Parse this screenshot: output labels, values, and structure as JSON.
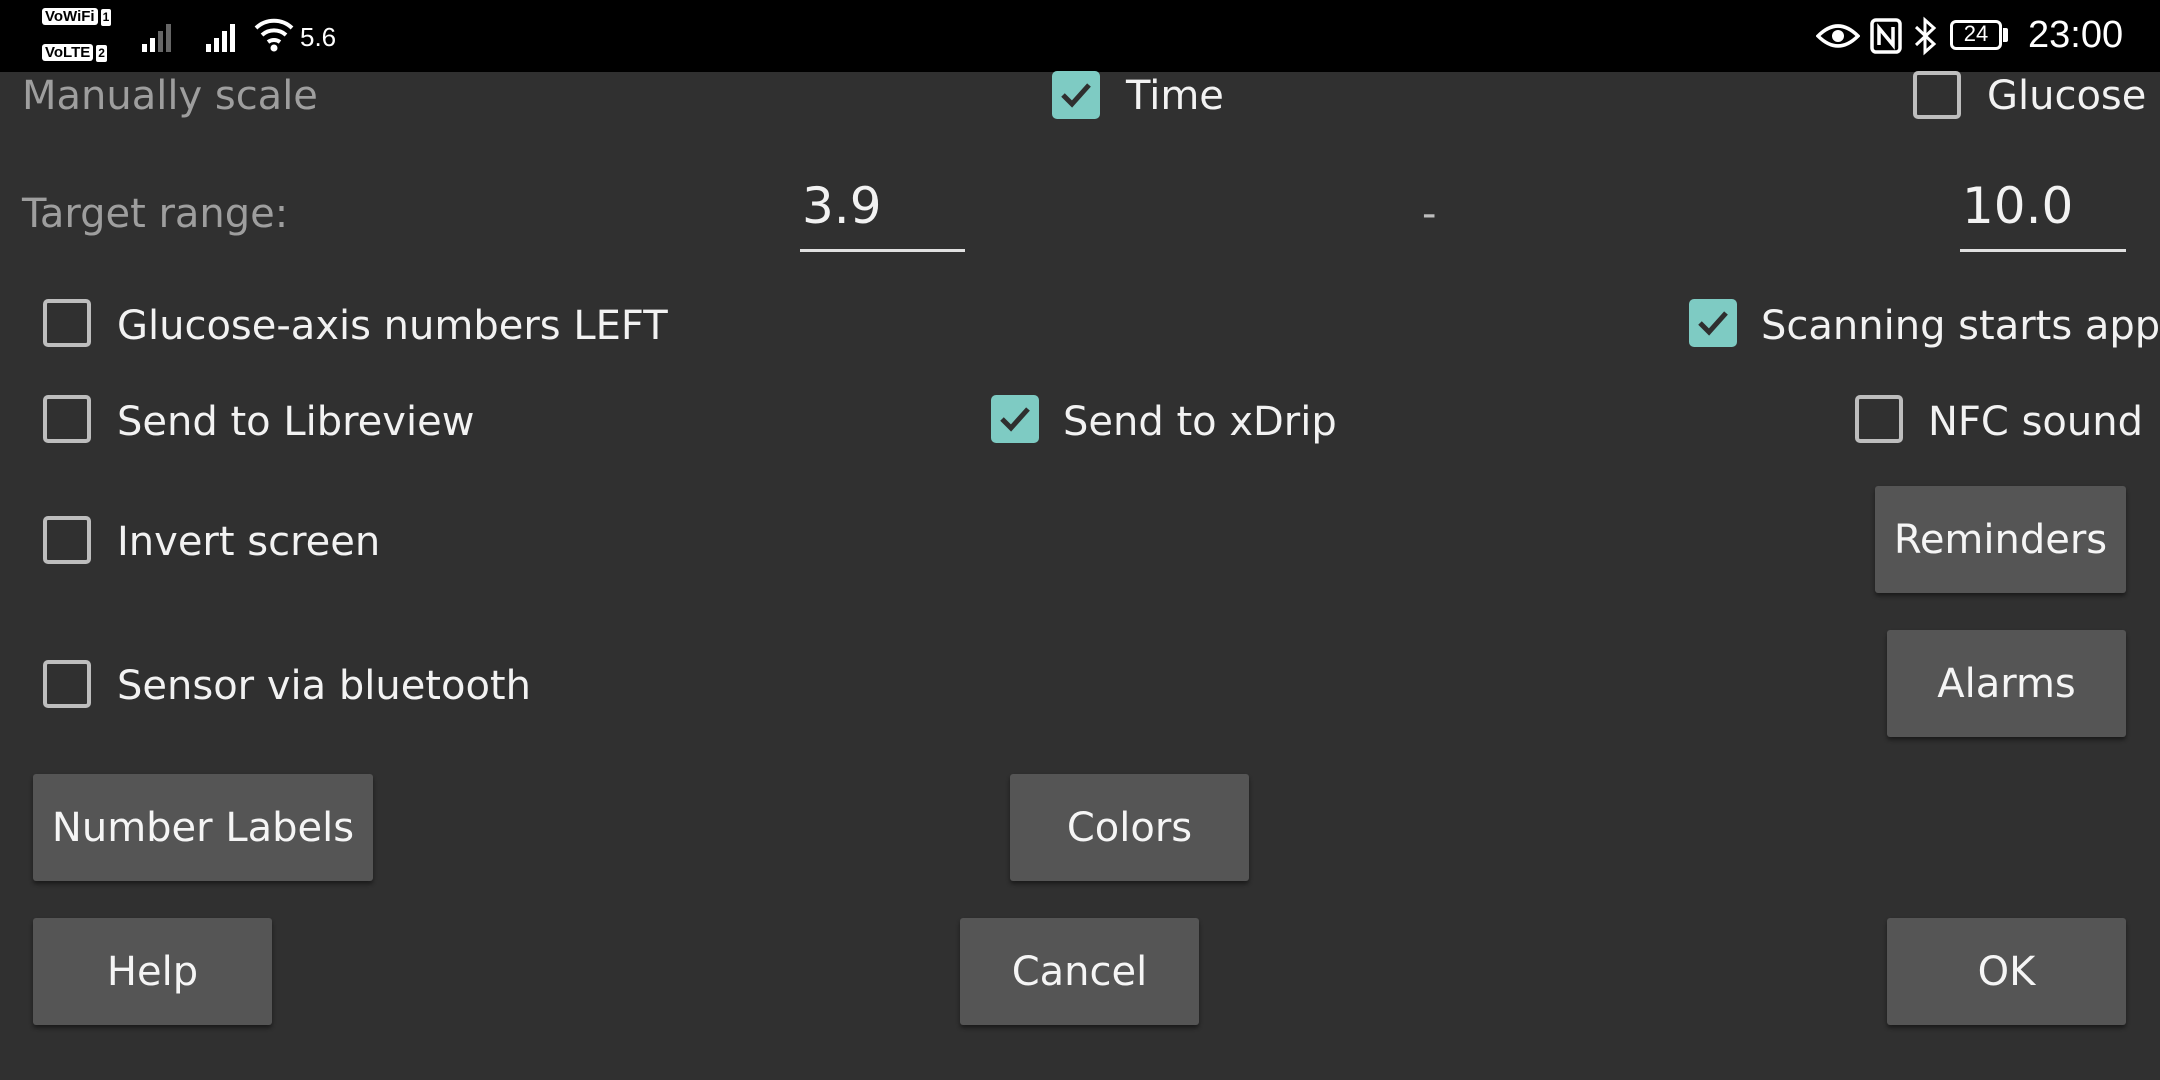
{
  "status_bar": {
    "vowifi": "VoWiFi",
    "vowifi_sim": "1",
    "volte": "VoLTE",
    "volte_sim": "2",
    "data_speed": "5.6",
    "battery": "24",
    "time": "23:00"
  },
  "scale": {
    "label": "Manually scale",
    "time_label": "Time",
    "time_checked": true,
    "glucose_label": "Glucose",
    "glucose_checked": false
  },
  "target_range": {
    "label": "Target range:",
    "low": "3.9",
    "separator": "-",
    "high": "10.0"
  },
  "options": {
    "glucose_axis_left": {
      "label": "Glucose-axis numbers LEFT",
      "checked": false
    },
    "scanning_starts_app": {
      "label": "Scanning starts app",
      "checked": true
    },
    "send_to_libreview": {
      "label": "Send to Libreview",
      "checked": false
    },
    "send_to_xdrip": {
      "label": "Send to xDrip",
      "checked": true
    },
    "nfc_sound": {
      "label": "NFC sound",
      "checked": false
    },
    "invert_screen": {
      "label": "Invert screen",
      "checked": false
    },
    "sensor_via_bluetooth": {
      "label": "Sensor via bluetooth",
      "checked": false
    }
  },
  "buttons": {
    "reminders": "Reminders",
    "alarms": "Alarms",
    "number_labels": "Number Labels",
    "colors": "Colors",
    "help": "Help",
    "cancel": "Cancel",
    "ok": "OK"
  },
  "colors": {
    "accent": "#7ecbc3",
    "background": "#303030",
    "button": "#555555"
  }
}
